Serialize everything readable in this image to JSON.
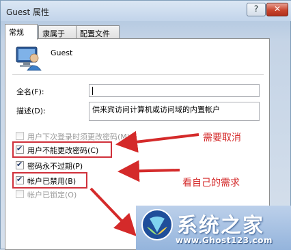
{
  "window": {
    "title": "Guest 属性",
    "help_glyph": "?",
    "close_glyph": "✕"
  },
  "tabs": [
    {
      "label": "常规",
      "active": true
    },
    {
      "label": "隶属于",
      "active": false
    },
    {
      "label": "配置文件",
      "active": false
    }
  ],
  "user": {
    "name": "Guest"
  },
  "fields": {
    "fullname_label": "全名(F):",
    "fullname_value": "",
    "description_label": "描述(D):",
    "description_value": "供来宾访问计算机或访问域的内置帐户"
  },
  "checkboxes": [
    {
      "label": "用户下次登录时须更改密码(M)",
      "checked": false,
      "enabled": false
    },
    {
      "label": "用户不能更改密码(C)",
      "checked": true,
      "enabled": true
    },
    {
      "label": "密码永不过期(P)",
      "checked": true,
      "enabled": true
    },
    {
      "label": "帐户已禁用(B)",
      "checked": true,
      "enabled": true
    },
    {
      "label": "帐户已锁定(O)",
      "checked": false,
      "enabled": false
    }
  ],
  "annotations": {
    "cancel_note": "需要取消",
    "needs_note": "看自己的需求",
    "color": "#d42a2a"
  },
  "watermark": {
    "title": "系统之家",
    "url": "www.Ghost123.com"
  },
  "colors": {
    "highlight_box": "#d0303a",
    "close_button": "#c9452e"
  }
}
